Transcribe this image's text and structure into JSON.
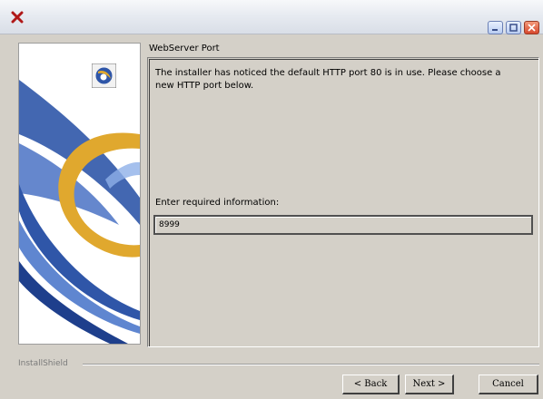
{
  "window": {
    "icon": "red-x-icon",
    "controls": [
      "minimize-icon",
      "maximize-icon",
      "close-icon"
    ]
  },
  "header": {
    "title": "WebServer Port"
  },
  "content": {
    "description": "The installer has noticed the default HTTP port 80 is in use. Please choose a new HTTP port below.",
    "field_label": "Enter required information:",
    "port_value": "8999"
  },
  "footer": {
    "brand": "InstallShield",
    "back_label": "< Back",
    "next_label": "Next >",
    "cancel_label": "Cancel"
  },
  "colors": {
    "dialog_bg": "#d4d0c8",
    "art_blue": "#2f56a8",
    "art_gold": "#e0a82e"
  }
}
